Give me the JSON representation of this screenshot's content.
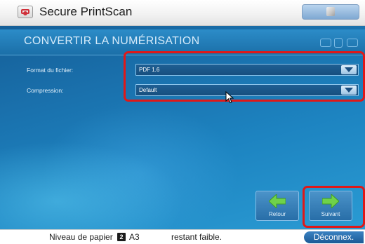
{
  "titlebar": {
    "app_title": "Secure PrintScan",
    "app_icon": "printscan-icon",
    "help_icon": "cube-icon"
  },
  "screen": {
    "title": "CONVERTIR LA NUMÉRISATION",
    "header_icons": [
      "window-icon",
      "window-icon",
      "window-icon"
    ]
  },
  "form": {
    "file_format": {
      "label": "Format du fichier:",
      "value": "PDF 1.6"
    },
    "compression": {
      "label": "Compression:",
      "value": "Default"
    }
  },
  "nav": {
    "back": {
      "label": "Retour",
      "icon": "arrow-left-icon"
    },
    "next": {
      "label": "Suivant",
      "icon": "arrow-right-icon"
    }
  },
  "statusbar": {
    "paper_prefix": "Niveau de papier",
    "paper_tray": "2",
    "paper_size": "A3",
    "paper_suffix": "restant faible.",
    "logout_label": "Déconnex."
  },
  "colors": {
    "highlight": "#e01818",
    "panel_blue": "#1d84c1",
    "arrow_green": "#6fd24a"
  }
}
